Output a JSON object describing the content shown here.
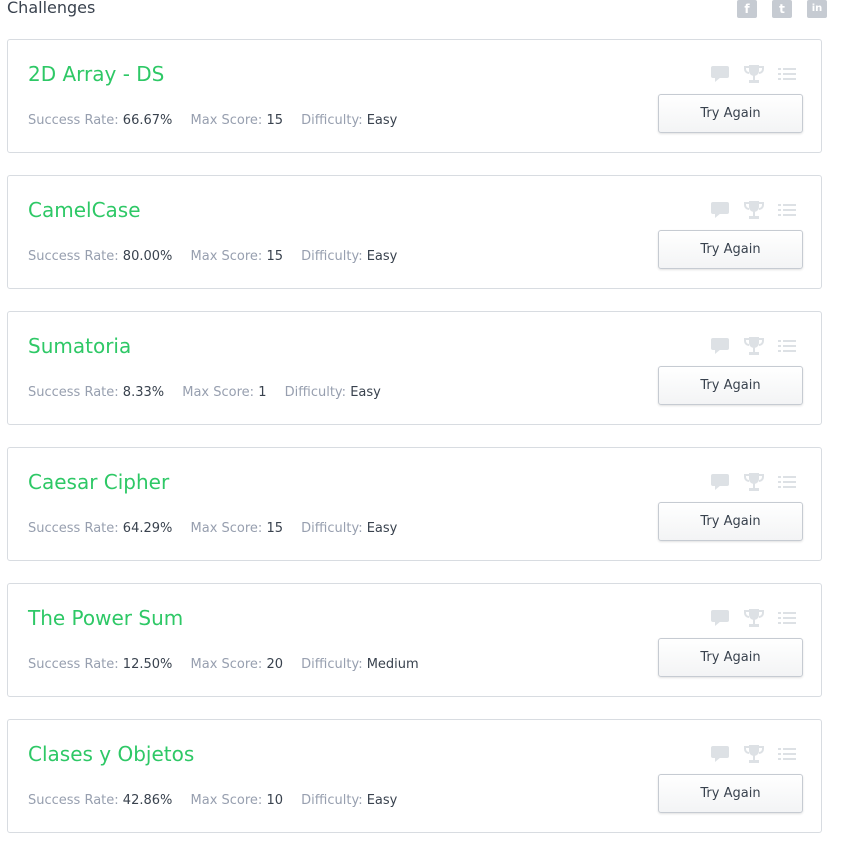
{
  "page": {
    "title": "Challenges"
  },
  "social": [
    {
      "name": "facebook",
      "glyph": "f"
    },
    {
      "name": "twitter",
      "glyph": "t"
    },
    {
      "name": "linkedin",
      "glyph": "in"
    }
  ],
  "labels": {
    "success_rate": "Success Rate:",
    "max_score": "Max Score:",
    "difficulty": "Difficulty:"
  },
  "challenges": [
    {
      "title": "2D Array - DS",
      "success_rate": "66.67%",
      "max_score": "15",
      "difficulty": "Easy",
      "button": "Try Again"
    },
    {
      "title": "CamelCase",
      "success_rate": "80.00%",
      "max_score": "15",
      "difficulty": "Easy",
      "button": "Try Again"
    },
    {
      "title": "Sumatoria",
      "success_rate": "8.33%",
      "max_score": "1",
      "difficulty": "Easy",
      "button": "Try Again"
    },
    {
      "title": "Caesar Cipher",
      "success_rate": "64.29%",
      "max_score": "15",
      "difficulty": "Easy",
      "button": "Try Again"
    },
    {
      "title": "The Power Sum",
      "success_rate": "12.50%",
      "max_score": "20",
      "difficulty": "Medium",
      "button": "Try Again"
    },
    {
      "title": "Clases y Objetos",
      "success_rate": "42.86%",
      "max_score": "10",
      "difficulty": "Easy",
      "button": "Try Again"
    }
  ],
  "card_icons": [
    "discussion-icon",
    "leaderboard-trophy-icon",
    "editorial-list-icon"
  ],
  "colors": {
    "title_green": "#2ec866",
    "label_gray": "#979faf",
    "text_dark": "#39424e",
    "icon_gray": "#dde1e5"
  }
}
